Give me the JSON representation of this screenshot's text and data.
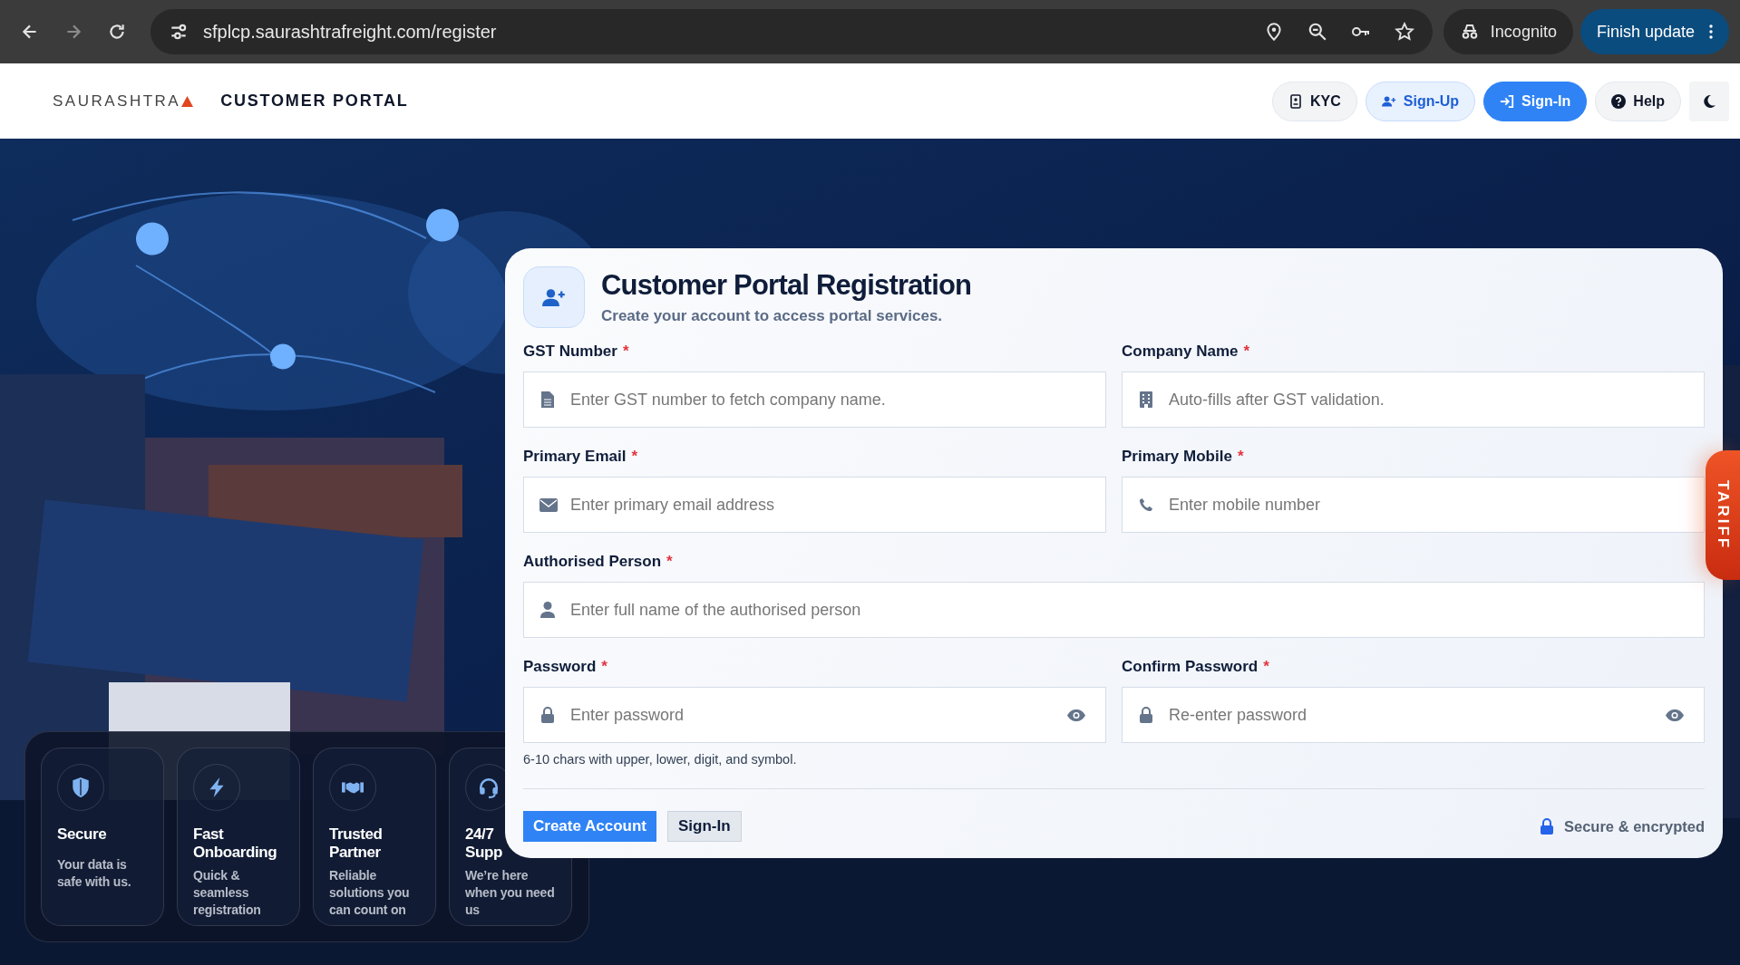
{
  "browser": {
    "url": "sfplcp.saurashtrafreight.com/register",
    "incognito_label": "Incognito",
    "update_button": "Finish update"
  },
  "header": {
    "logo": "SAURASHTRA",
    "portal_title": "CUSTOMER PORTAL",
    "nav": [
      {
        "label": "KYC",
        "kind": "plain"
      },
      {
        "label": "Sign-Up",
        "kind": "soft"
      },
      {
        "label": "Sign-In",
        "kind": "primary"
      },
      {
        "label": "Help",
        "kind": "plain"
      }
    ]
  },
  "form": {
    "title": "Customer Portal Registration",
    "subtitle": "Create your account to access portal services.",
    "fields": [
      {
        "label": "GST Number",
        "required_mark": "*",
        "placeholder": "Enter GST number to fetch company name.",
        "kind": "half",
        "reveal_toggle": false
      },
      {
        "label": "Company Name",
        "required_mark": "*",
        "placeholder": "Auto-fills after GST validation.",
        "kind": "half",
        "reveal_toggle": false
      },
      {
        "label": "Primary Email",
        "required_mark": "*",
        "placeholder": "Enter primary email address",
        "kind": "half",
        "reveal_toggle": false
      },
      {
        "label": "Primary Mobile",
        "required_mark": "*",
        "placeholder": "Enter mobile number",
        "kind": "half",
        "reveal_toggle": false
      },
      {
        "label": "Authorised Person",
        "required_mark": "*",
        "placeholder": "Enter full name of the authorised person",
        "kind": "full",
        "reveal_toggle": false
      },
      {
        "label": "Password",
        "required_mark": "*",
        "placeholder": "Enter password",
        "kind": "half",
        "reveal_toggle": true
      },
      {
        "label": "Confirm Password",
        "required_mark": "*",
        "placeholder": "Re-enter password",
        "kind": "half",
        "reveal_toggle": true
      }
    ],
    "hint": "6-10 chars with upper, lower, digit, and symbol.",
    "primary_button": "Create Account",
    "secondary_button": "Sign-In",
    "security_note": "Secure & encrypted"
  },
  "features": [
    {
      "title": "Secure",
      "text": "Your data is safe with us."
    },
    {
      "title": "Fast Onboarding",
      "text": "Quick & seamless registration"
    },
    {
      "title": "Trusted Partner",
      "text": "Reliable solutions you can count on"
    },
    {
      "title": "24/7 Supp",
      "text": "We’re here when you need us"
    }
  ],
  "side_tab": "TARIFF"
}
